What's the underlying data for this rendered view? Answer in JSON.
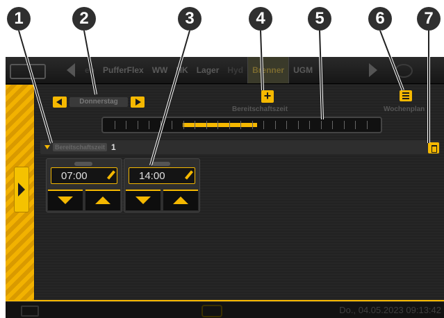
{
  "callouts": [
    "1",
    "2",
    "3",
    "4",
    "5",
    "6",
    "7"
  ],
  "topbar": {
    "logo_text": "",
    "tabs": [
      "eb",
      "PufferFlex",
      "WW",
      "HK",
      "Lager",
      "Hyd",
      "Brenner",
      "UGM"
    ],
    "active_tab": "Brenner"
  },
  "schedule": {
    "day_label": "Donnerstag",
    "add_label": "Bereitschaftszeit",
    "weekview_label": "Wochenplan",
    "timeline": {
      "active_start_fraction": 0.29,
      "active_end_fraction": 0.56
    },
    "section_label": "Bereitschaftszeit",
    "section_count": "1",
    "time_slots": [
      {
        "time": "07:00"
      },
      {
        "time": "14:00"
      }
    ]
  },
  "status": {
    "datetime": "Do., 04.05.2023 09:13:42"
  },
  "colors": {
    "accent": "#f5b800",
    "background": "#1c1c1c"
  }
}
